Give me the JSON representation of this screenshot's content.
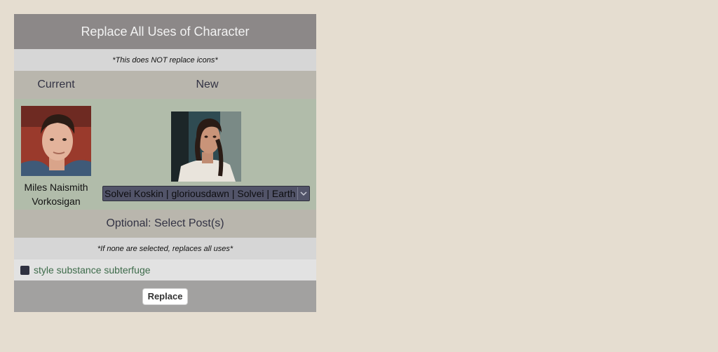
{
  "header": {
    "title": "Replace All Uses of Character"
  },
  "note_top": "*This does NOT replace icons*",
  "columns": {
    "current": "Current",
    "new": "New"
  },
  "current_character": {
    "name": "Miles Naismith Vorkosigan",
    "icon": "portrait-male"
  },
  "new_character": {
    "icon": "portrait-female",
    "select_value": "Solvei Koskin | gloriousdawn | Solvei | Earth"
  },
  "optional_label": "Optional: Select Post(s)",
  "note_bottom": "*If none are selected, replaces all uses*",
  "posts": [
    {
      "title": "style substance subterfuge",
      "checked": false
    }
  ],
  "replace_button": "Replace",
  "colors": {
    "background": "#e5ddd0",
    "header": "#8c8888",
    "row_tan": "#b9b6ad",
    "row_green": "#b1bcaa",
    "link": "#3d6b4a"
  }
}
